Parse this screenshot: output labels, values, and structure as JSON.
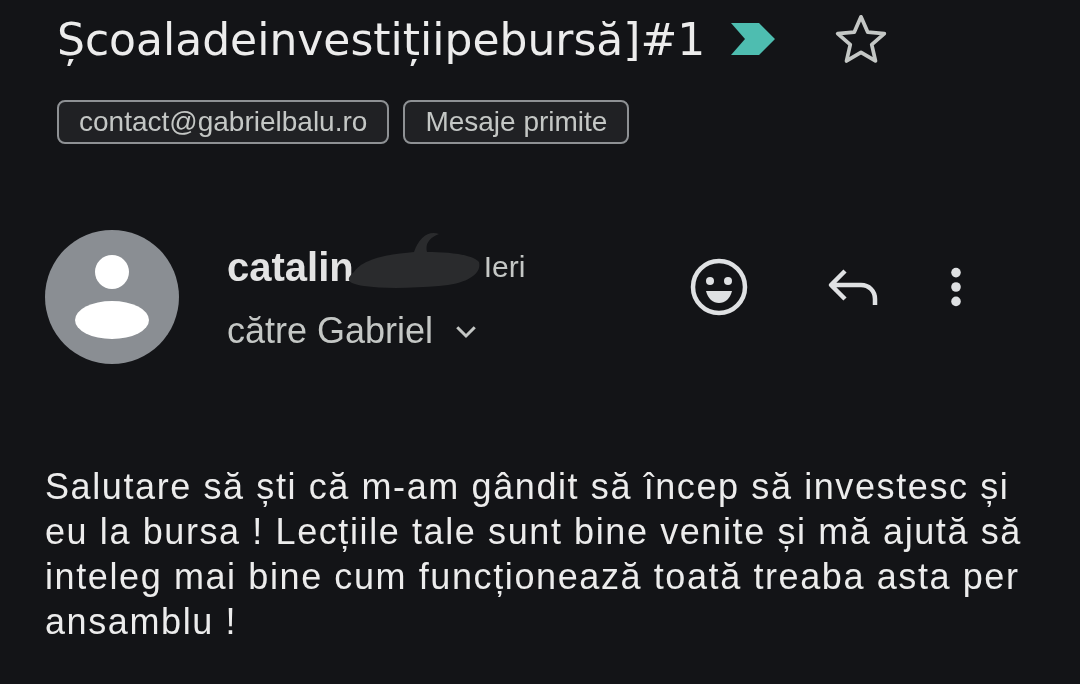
{
  "subject": {
    "title": "Școaladeinvestițiipebursă]#1",
    "important": true,
    "starred": false
  },
  "labels": [
    "contact@gabrielbalu.ro",
    "Mesaje primite"
  ],
  "message": {
    "sender": "catalin",
    "sender_redacted": true,
    "time": "Ieri",
    "recipient": "către Gabriel",
    "body": "Salutare să ști că m-am gândit să încep să investesc și eu la bursa ! Lecțiile tale sunt bine venite și mă ajută să inteleg mai bine cum funcționează toată treaba asta per ansamblu !"
  }
}
